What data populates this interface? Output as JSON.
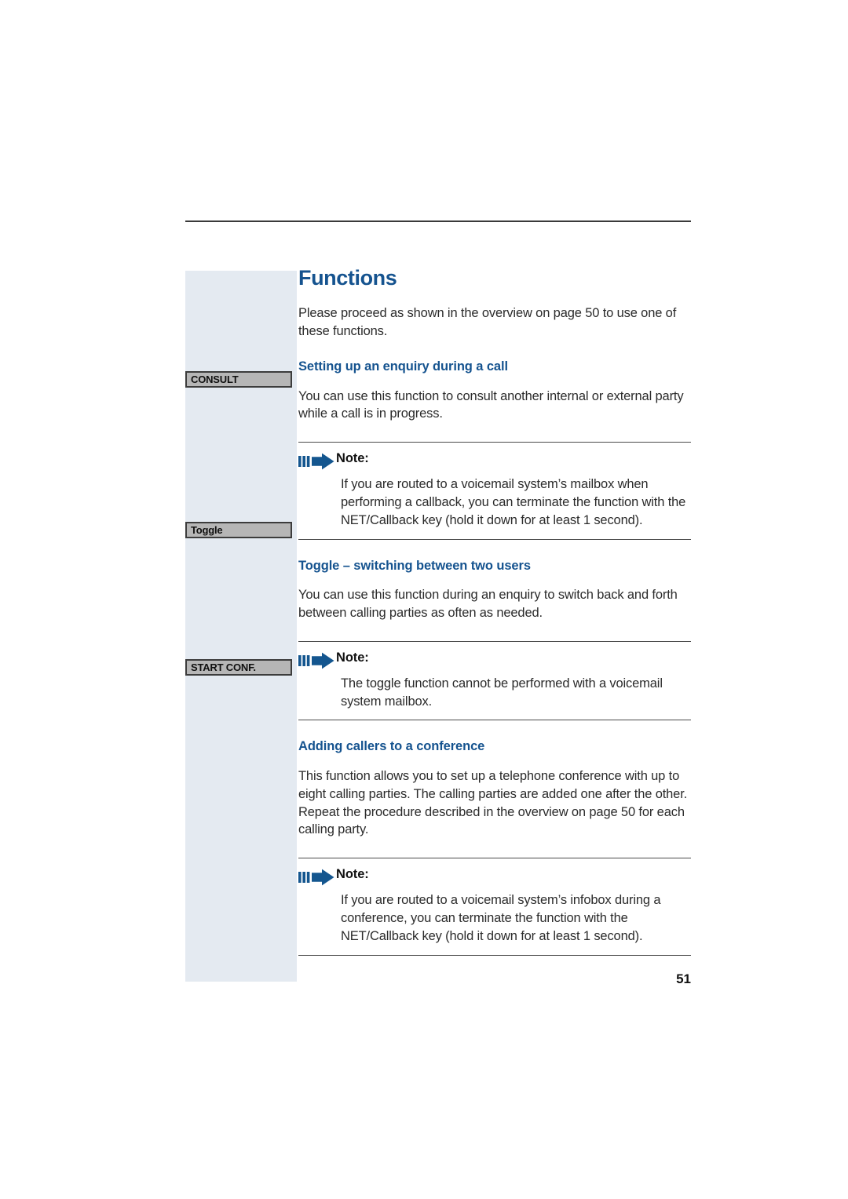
{
  "document": {
    "page_number": "51",
    "title": "Functions",
    "intro": "Please proceed as shown in the overview on page 50 to use one of these functions."
  },
  "colors": {
    "heading_blue": "#15538f",
    "sidebar_bg": "#e4eaf1",
    "key_badge_bg": "#b6b6b6",
    "key_badge_border": "#3c3c3c",
    "rule": "#3a3a3a",
    "body_text": "#2b2b2b"
  },
  "sidebar": {
    "keys": [
      {
        "label": "CONSULT",
        "icon": "softkey-label"
      },
      {
        "label": "Toggle",
        "icon": "softkey-label"
      },
      {
        "label": "START CONF.",
        "icon": "softkey-label"
      }
    ]
  },
  "sections": [
    {
      "heading": "Setting up an enquiry during a call",
      "body": "You can use this function to consult another internal or external party while a call is in progress.",
      "note": {
        "icon": "note-arrow-icon",
        "label": "Note:",
        "body": "If you are routed to a voicemail system’s mailbox when performing a callback, you can terminate the function with the NET/Callback key (hold it down for at least 1 second)."
      }
    },
    {
      "heading": "Toggle – switching between two users",
      "body": "You can use this function during an enquiry to switch back and forth between calling parties as often as needed.",
      "note": {
        "icon": "note-arrow-icon",
        "label": "Note:",
        "body": "The toggle function cannot be performed with a voicemail system mailbox."
      }
    },
    {
      "heading": "Adding callers to a conference",
      "body": "This function allows you to set up a telephone conference with up to eight calling parties. The calling parties are added one after the other. Repeat the procedure described in the overview on page 50 for each calling party.",
      "note": {
        "icon": "note-arrow-icon",
        "label": "Note:",
        "body": "If you are routed to a voicemail system’s infobox during a conference, you can terminate the function with the NET/Callback key (hold it down for at least 1 second)."
      }
    }
  ]
}
